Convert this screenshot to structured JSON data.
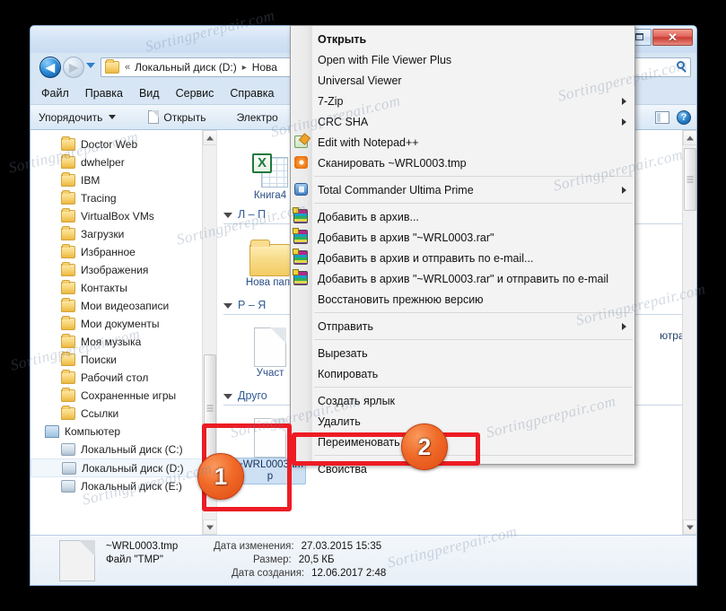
{
  "window": {
    "controls": {
      "restore": "restore-icon",
      "close": "✕"
    }
  },
  "address": {
    "chevron": "«",
    "crumb1": "Локальный диск (D:)",
    "separator": "▸",
    "crumb2": "Нова",
    "search_placeholder": ""
  },
  "menubar": {
    "items": [
      {
        "label": "Файл"
      },
      {
        "label": "Правка"
      },
      {
        "label": "Вид"
      },
      {
        "label": "Сервис"
      },
      {
        "label": "Справка"
      }
    ]
  },
  "toolbar": {
    "organize": "Упорядочить",
    "open": "Открыть",
    "email": "Электро",
    "help": "?"
  },
  "navpane": {
    "items": [
      {
        "label": "Doctor Web",
        "icon": "folder-icon",
        "level": 2,
        "selected": false
      },
      {
        "label": "dwhelper",
        "icon": "folder-icon",
        "level": 2,
        "selected": false
      },
      {
        "label": "IBM",
        "icon": "folder-icon",
        "level": 2,
        "selected": false
      },
      {
        "label": "Tracing",
        "icon": "folder-icon",
        "level": 2,
        "selected": false
      },
      {
        "label": "VirtualBox VMs",
        "icon": "folder-icon",
        "level": 2,
        "selected": false
      },
      {
        "label": "Загрузки",
        "icon": "downloads-folder-icon",
        "level": 2,
        "selected": false
      },
      {
        "label": "Избранное",
        "icon": "favorites-folder-icon",
        "level": 2,
        "selected": false
      },
      {
        "label": "Изображения",
        "icon": "pictures-folder-icon",
        "level": 2,
        "selected": false
      },
      {
        "label": "Контакты",
        "icon": "contacts-folder-icon",
        "level": 2,
        "selected": false
      },
      {
        "label": "Мои видеозаписи",
        "icon": "videos-folder-icon",
        "level": 2,
        "selected": false
      },
      {
        "label": "Мои документы",
        "icon": "documents-folder-icon",
        "level": 2,
        "selected": false
      },
      {
        "label": "Моя музыка",
        "icon": "music-folder-icon",
        "level": 2,
        "selected": false
      },
      {
        "label": "Поиски",
        "icon": "searches-folder-icon",
        "level": 2,
        "selected": false
      },
      {
        "label": "Рабочий стол",
        "icon": "desktop-folder-icon",
        "level": 2,
        "selected": false
      },
      {
        "label": "Сохраненные игры",
        "icon": "savedgames-folder-icon",
        "level": 2,
        "selected": false
      },
      {
        "label": "Ссылки",
        "icon": "links-folder-icon",
        "level": 2,
        "selected": false
      },
      {
        "label": "Компьютер",
        "icon": "computer-icon",
        "level": 1,
        "selected": false
      },
      {
        "label": "Локальный диск (C:)",
        "icon": "system-drive-icon",
        "level": 2,
        "selected": false
      },
      {
        "label": "Локальный диск (D:)",
        "icon": "drive-icon",
        "level": 2,
        "selected": true
      },
      {
        "label": "Локальный диск (E:)",
        "icon": "drive-icon",
        "level": 2,
        "selected": false
      }
    ]
  },
  "filepane": {
    "groups": [
      {
        "header": "",
        "items": [
          {
            "label": "Книга4",
            "icon": "excel-file-icon",
            "selected": false
          }
        ]
      },
      {
        "header": "Л – П",
        "items": [
          {
            "label": "Нова папк",
            "icon": "folder-icon",
            "selected": false
          }
        ]
      },
      {
        "header": "Р – Я",
        "items": [
          {
            "label": "Участ",
            "icon": "blank-file-icon",
            "selected": false
          }
        ]
      },
      {
        "header": "Друго",
        "items": [
          {
            "label": "~WRL0003.tmp",
            "icon": "tmp-file-icon",
            "selected": true
          }
        ]
      }
    ],
    "hint": "ютра."
  },
  "details": {
    "filename": "~WRL0003.tmp",
    "filetype": "Файл \"TMP\"",
    "modified_label": "Дата изменения:",
    "modified_value": "27.03.2015 15:35",
    "size_label": "Размер:",
    "size_value": "20,5 КБ",
    "created_label": "Дата создания:",
    "created_value": "12.06.2017 2:48"
  },
  "context_menu": {
    "items": [
      {
        "label": "Открыть",
        "bold": true,
        "icon": null,
        "submenu": false
      },
      {
        "label": "Open with File Viewer Plus",
        "bold": false,
        "icon": null,
        "submenu": false
      },
      {
        "label": "Universal Viewer",
        "bold": false,
        "icon": null,
        "submenu": false
      },
      {
        "label": "7-Zip",
        "bold": false,
        "icon": null,
        "submenu": true
      },
      {
        "label": "CRC SHA",
        "bold": false,
        "icon": null,
        "submenu": true
      },
      {
        "label": "Edit with Notepad++",
        "bold": false,
        "icon": "notepadpp-icon",
        "submenu": false
      },
      {
        "label": "Сканировать ~WRL0003.tmp",
        "bold": false,
        "icon": "avast-icon",
        "submenu": false
      },
      {
        "separator": true
      },
      {
        "label": "Total Commander Ultima Prime",
        "bold": false,
        "icon": "totalcommander-icon",
        "submenu": true
      },
      {
        "separator": true
      },
      {
        "label": "Добавить в архив...",
        "bold": false,
        "icon": "winrar-icon",
        "submenu": false
      },
      {
        "label": "Добавить в архив \"~WRL0003.rar\"",
        "bold": false,
        "icon": "winrar-icon",
        "submenu": false
      },
      {
        "label": "Добавить в архив и отправить по e-mail...",
        "bold": false,
        "icon": "winrar-icon",
        "submenu": false
      },
      {
        "label": "Добавить в архив \"~WRL0003.rar\" и отправить по e-mail",
        "bold": false,
        "icon": "winrar-icon",
        "submenu": false
      },
      {
        "label": "Восстановить прежнюю версию",
        "bold": false,
        "icon": null,
        "submenu": false
      },
      {
        "separator": true
      },
      {
        "label": "Отправить",
        "bold": false,
        "icon": null,
        "submenu": true
      },
      {
        "separator": true
      },
      {
        "label": "Вырезать",
        "bold": false,
        "icon": null,
        "submenu": false
      },
      {
        "label": "Копировать",
        "bold": false,
        "icon": null,
        "submenu": false
      },
      {
        "separator": true
      },
      {
        "label": "Создать ярлык",
        "bold": false,
        "icon": null,
        "submenu": false
      },
      {
        "label": "Удалить",
        "bold": false,
        "icon": null,
        "submenu": false
      },
      {
        "label": "Переименовать",
        "bold": false,
        "icon": null,
        "submenu": false
      },
      {
        "separator": true
      },
      {
        "label": "Свойства",
        "bold": false,
        "icon": null,
        "submenu": false
      }
    ]
  },
  "annotations": [
    {
      "number": "1",
      "color": "#ed1c24"
    },
    {
      "number": "2",
      "color": "#ed1c24"
    }
  ],
  "watermarks": [
    "Sortingperepair.com",
    "Sortingperepair.com",
    "Sortingperepair.com",
    "Sortingperepair.com",
    "Sortingperepair.com",
    "Sortingperepair.com",
    "Sortingperepair.com",
    "Sortingperepair.com",
    "Sortingperepair.com",
    "Sortingperepair.com",
    "Sortingperepair.com",
    "Sortingperepair.com"
  ]
}
